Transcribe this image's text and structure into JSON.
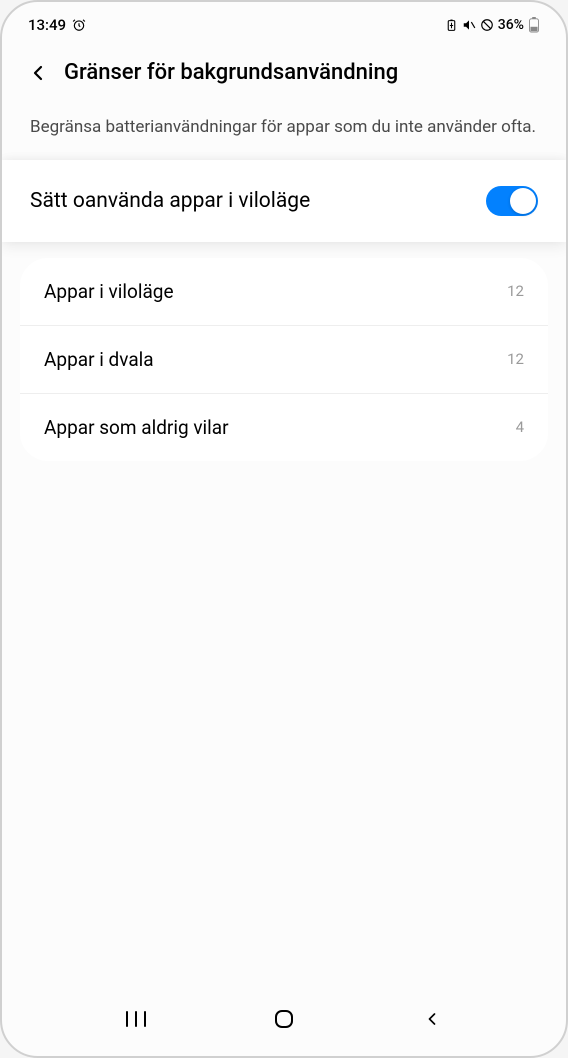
{
  "statusBar": {
    "time": "13:49",
    "batteryPercent": "36%"
  },
  "header": {
    "title": "Gränser för bakgrundsanvändning"
  },
  "description": "Begränsa batterianvändningar för appar som du inte använder ofta.",
  "toggle": {
    "label": "Sätt oanvända appar i viloläge",
    "enabled": true
  },
  "list": [
    {
      "label": "Appar i viloläge",
      "count": "12"
    },
    {
      "label": "Appar i dvala",
      "count": "12"
    },
    {
      "label": "Appar som aldrig vilar",
      "count": "4"
    }
  ]
}
